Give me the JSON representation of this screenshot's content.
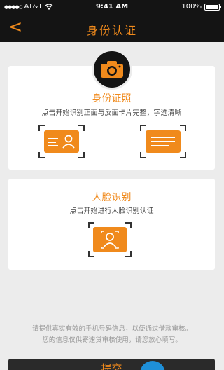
{
  "status": {
    "carrier": "AT&T",
    "time": "9:41 AM",
    "battery": "100%"
  },
  "nav": {
    "back": "<",
    "title": "身份认证"
  },
  "id_card": {
    "title": "身份证照",
    "desc": "点击开始识别正面与反面卡片完整，字迹清晰"
  },
  "face": {
    "title": "人脸识别",
    "desc": "点击开始进行人脸识别认证"
  },
  "footer": {
    "line1": "请提供真实有效的手机号码信息，以便通过借款审核。",
    "line2": "您的信息仅供寄速贷审核使用，请您放心填写。"
  },
  "submit_label": "提交"
}
